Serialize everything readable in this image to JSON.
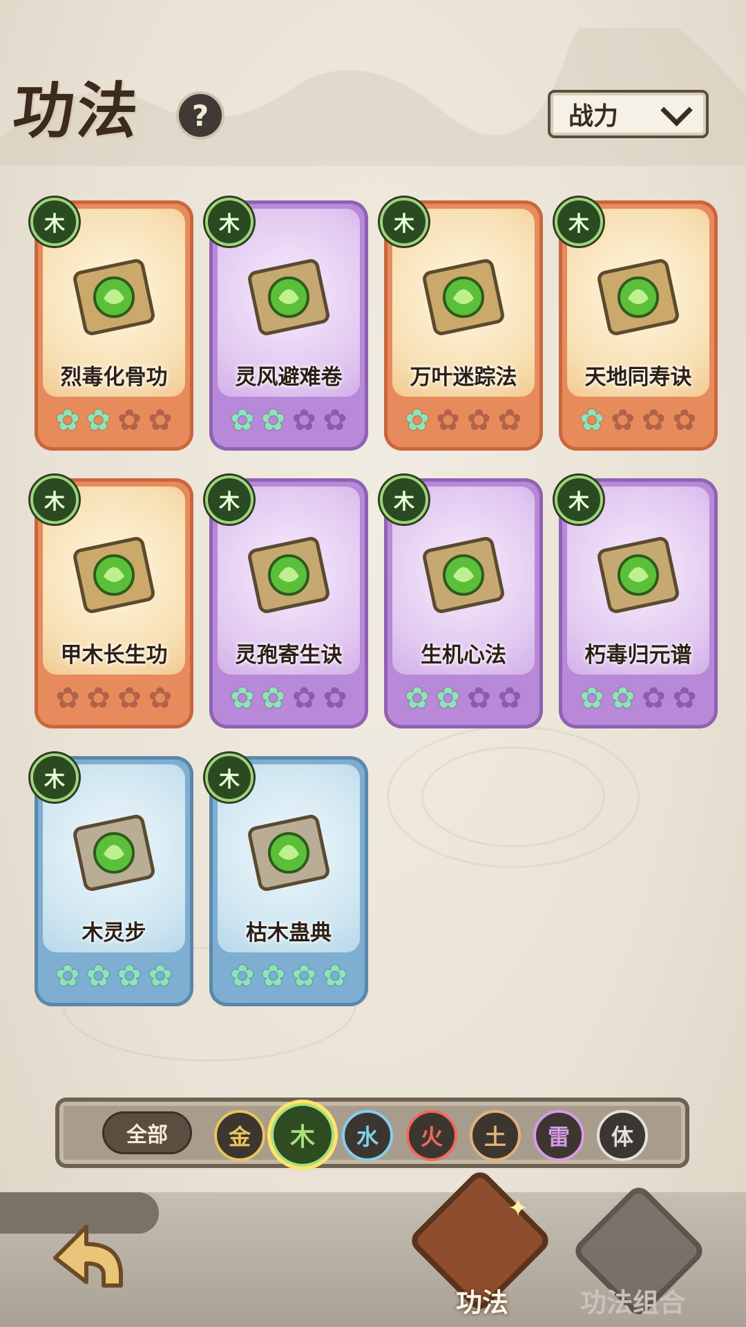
{
  "header": {
    "title": "功法",
    "help_icon": "?"
  },
  "sort": {
    "label": "战力"
  },
  "cards": [
    {
      "name": "烈毒化骨功",
      "element": "木",
      "rarity": "orange",
      "stars_on": 1.5,
      "icon": "dragon-frame-poison-skull"
    },
    {
      "name": "灵风避难卷",
      "element": "木",
      "rarity": "purple",
      "stars_on": 2,
      "icon": "scroll-leaf"
    },
    {
      "name": "万叶迷踪法",
      "element": "木",
      "rarity": "orange",
      "stars_on": 1,
      "icon": "dragon-frame-leaves"
    },
    {
      "name": "天地同寿诀",
      "element": "木",
      "rarity": "orange",
      "stars_on": 1,
      "icon": "dragon-frame-statue"
    },
    {
      "name": "甲木长生功",
      "element": "木",
      "rarity": "orange",
      "stars_on": 0,
      "icon": "dragon-frame-tree"
    },
    {
      "name": "灵孢寄生诀",
      "element": "木",
      "rarity": "purple",
      "stars_on": 2,
      "icon": "scroll-spore-figure"
    },
    {
      "name": "生机心法",
      "element": "木",
      "rarity": "purple",
      "stars_on": 2,
      "icon": "scroll-vitality"
    },
    {
      "name": "朽毒归元谱",
      "element": "木",
      "rarity": "purple",
      "stars_on": 1.5,
      "icon": "scroll-skull"
    },
    {
      "name": "木灵步",
      "element": "木",
      "rarity": "blue",
      "stars_on": 4,
      "icon": "book-leaf"
    },
    {
      "name": "枯木蛊典",
      "element": "木",
      "rarity": "blue",
      "stars_on": 3.5,
      "icon": "book-skull"
    }
  ],
  "filter": {
    "all_label": "全部",
    "elements": [
      {
        "label": "金",
        "color": "#e8c55a",
        "active": false
      },
      {
        "label": "木",
        "color": "#a8e07d",
        "active": true
      },
      {
        "label": "水",
        "color": "#7fd1f0",
        "active": false
      },
      {
        "label": "火",
        "color": "#ef6b5b",
        "active": false
      },
      {
        "label": "土",
        "color": "#e2b27a",
        "active": false
      },
      {
        "label": "雷",
        "color": "#d59be8",
        "active": false
      },
      {
        "label": "体",
        "color": "#e0e0e0",
        "active": false
      }
    ]
  },
  "tabs": {
    "active": "功法",
    "inactive": "功法组合"
  }
}
